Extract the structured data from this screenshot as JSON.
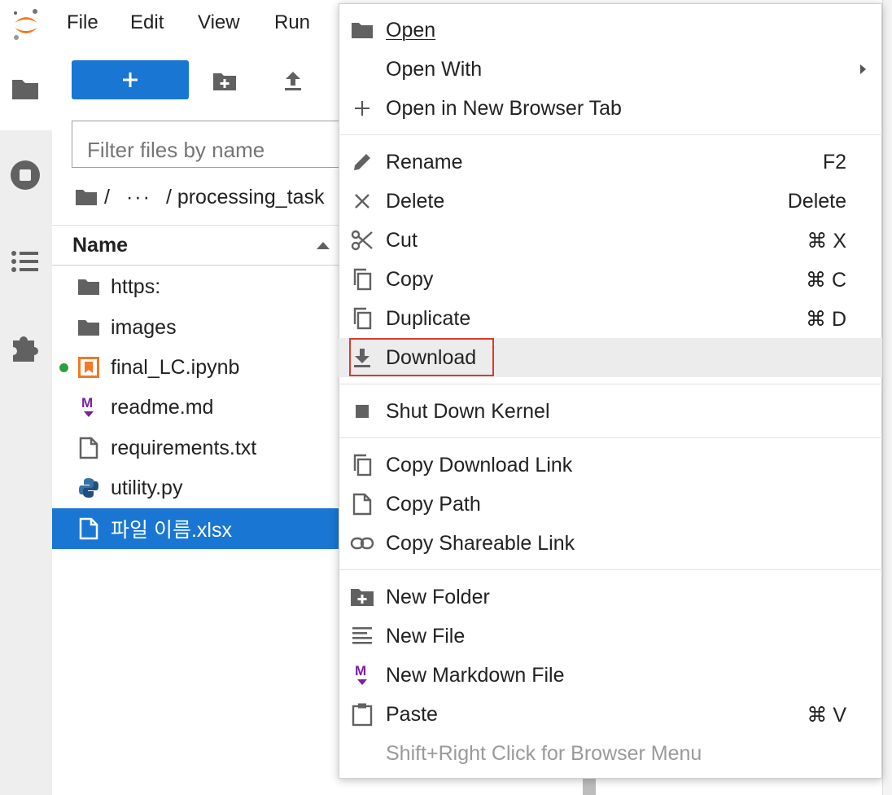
{
  "menubar": {
    "items": [
      "File",
      "Edit",
      "View",
      "Run"
    ]
  },
  "filebrowser": {
    "filter_placeholder": "Filter files by name",
    "breadcrumb": {
      "root": "/",
      "ellipsis": "···",
      "path": "/ processing_task"
    },
    "header": {
      "name": "Name"
    },
    "files": [
      {
        "name": "https:",
        "type": "folder"
      },
      {
        "name": "images",
        "type": "folder"
      },
      {
        "name": "final_LC.ipynb",
        "type": "notebook",
        "running": true
      },
      {
        "name": "readme.md",
        "type": "markdown"
      },
      {
        "name": "requirements.txt",
        "type": "text"
      },
      {
        "name": "utility.py",
        "type": "python"
      },
      {
        "name": "파일 이름.xlsx",
        "type": "file",
        "selected": true
      }
    ]
  },
  "context_menu": {
    "items": [
      {
        "label": "Open",
        "shortcut": "",
        "icon": "folder-icon"
      },
      {
        "label": "Open With",
        "shortcut": "",
        "icon": "",
        "submenu": true
      },
      {
        "label": "Open in New Browser Tab",
        "shortcut": "",
        "icon": "plus-icon"
      },
      {
        "label": "Rename",
        "shortcut": "F2",
        "icon": "pencil-icon"
      },
      {
        "label": "Delete",
        "shortcut": "Delete",
        "icon": "close-icon"
      },
      {
        "label": "Cut",
        "shortcut": "⌘ X",
        "icon": "scissors-icon"
      },
      {
        "label": "Copy",
        "shortcut": "⌘ C",
        "icon": "copy-icon"
      },
      {
        "label": "Duplicate",
        "shortcut": "⌘ D",
        "icon": "duplicate-icon"
      },
      {
        "label": "Download",
        "shortcut": "",
        "icon": "download-icon",
        "highlighted": true
      },
      {
        "label": "Shut Down Kernel",
        "shortcut": "",
        "icon": "stop-icon"
      },
      {
        "label": "Copy Download Link",
        "shortcut": "",
        "icon": "copy-icon"
      },
      {
        "label": "Copy Path",
        "shortcut": "",
        "icon": "file-icon"
      },
      {
        "label": "Copy Shareable Link",
        "shortcut": "",
        "icon": "link-icon"
      },
      {
        "label": "New Folder",
        "shortcut": "",
        "icon": "new-folder-icon"
      },
      {
        "label": "New File",
        "shortcut": "",
        "icon": "text-lines-icon"
      },
      {
        "label": "New Markdown File",
        "shortcut": "",
        "icon": "markdown-icon"
      },
      {
        "label": "Paste",
        "shortcut": "⌘ V",
        "icon": "clipboard-icon"
      },
      {
        "label": "Shift+Right Click for Browser Menu",
        "shortcut": "",
        "icon": "",
        "disabled": true
      }
    ]
  },
  "colors": {
    "accent": "#1976d2",
    "highlight_border": "#e0392b",
    "running_dot": "#2e9e3e",
    "jupyter_orange": "#f37726",
    "markdown_purple": "#7b1fa2"
  }
}
